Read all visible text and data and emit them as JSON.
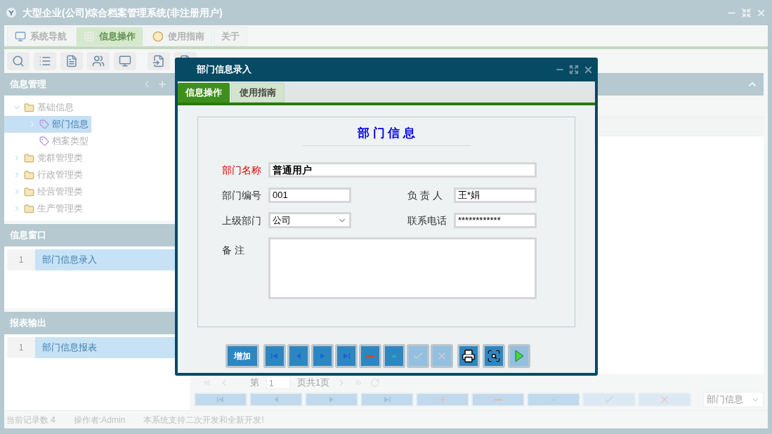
{
  "app": {
    "title": "大型企业(公司)综合档案管理系统(非注册用户)"
  },
  "main_tabs": [
    {
      "label": "系统导航",
      "selected": false,
      "kind": "monitor"
    },
    {
      "label": "信息操作",
      "selected": true,
      "kind": "grid"
    },
    {
      "label": "使用指南",
      "selected": false,
      "kind": "clock"
    },
    {
      "label": "关于",
      "selected": false,
      "kind": "none"
    }
  ],
  "toolbar": [
    {
      "kind": "search"
    },
    {
      "kind": "list"
    },
    {
      "kind": "document"
    },
    {
      "kind": "users"
    },
    {
      "kind": "monitor"
    },
    {
      "kind": "import"
    },
    {
      "kind": "document"
    }
  ],
  "sidebar": {
    "title": "信息管理",
    "tree": [
      {
        "label": "基础信息",
        "kind": "folder",
        "expanded": true,
        "selected": false,
        "children": [
          {
            "label": "部门信息",
            "kind": "leaf",
            "expanded": false,
            "selected": true
          },
          {
            "label": "档案类型",
            "kind": "leaf",
            "selected": false
          }
        ]
      },
      {
        "label": "党群管理类",
        "kind": "folder",
        "expanded": false,
        "selected": false
      },
      {
        "label": "行政管理类",
        "kind": "folder",
        "expanded": false,
        "selected": false
      },
      {
        "label": "经营管理类",
        "kind": "folder",
        "expanded": false,
        "selected": false
      },
      {
        "label": "生产管理类",
        "kind": "folder",
        "expanded": false,
        "selected": false
      }
    ]
  },
  "windows": {
    "title": "信息窗口",
    "items": [
      {
        "index": "1",
        "label": "部门信息录入"
      }
    ]
  },
  "reports": {
    "title": "报表输出",
    "items": [
      {
        "index": "1",
        "label": "部门信息报表"
      }
    ]
  },
  "pager": {
    "prefix": "第",
    "page": "1",
    "suffix": "页共1页"
  },
  "grid_buttons": [
    {
      "kind": "first",
      "disabled": false
    },
    {
      "kind": "prev",
      "disabled": false
    },
    {
      "kind": "next",
      "disabled": false
    },
    {
      "kind": "last",
      "disabled": false
    },
    {
      "kind": "plus",
      "disabled": false
    },
    {
      "kind": "minus",
      "disabled": false
    },
    {
      "kind": "up",
      "disabled": false
    },
    {
      "kind": "check",
      "disabled": true
    },
    {
      "kind": "x",
      "disabled": true
    }
  ],
  "filter_select": {
    "value": "部门信息"
  },
  "status_bar": [
    "当前记录数 4",
    "操作者:Admin",
    "本系统支持二次开发和全新开发!"
  ],
  "dialog": {
    "title": "部门信息录入",
    "tabs": [
      {
        "label": "信息操作",
        "selected": true
      },
      {
        "label": "使用指南",
        "selected": false
      }
    ],
    "form": {
      "heading": "部 门 信 息",
      "rows": [
        [
          {
            "label": "部门名称",
            "value": "普通用户",
            "required": true,
            "bold": true,
            "kind": "text"
          }
        ],
        [
          {
            "label": "部门编号",
            "value": "001",
            "required": false,
            "bold": false,
            "kind": "text"
          },
          {
            "label": "负 责 人",
            "value": "王*娟",
            "required": false,
            "bold": false,
            "kind": "text"
          }
        ],
        [
          {
            "label": "上级部门",
            "value": "公司",
            "required": false,
            "bold": false,
            "kind": "select"
          },
          {
            "label": "联系电话",
            "value": "************",
            "required": false,
            "bold": false,
            "kind": "text"
          }
        ],
        [
          {
            "label": "备 注",
            "required": false,
            "kind": "textarea"
          }
        ]
      ]
    },
    "buttons": [
      {
        "kind": "text",
        "label": "增加",
        "disabled": false
      },
      {
        "kind": "first",
        "disabled": false
      },
      {
        "kind": "prev",
        "disabled": false
      },
      {
        "kind": "next",
        "disabled": false
      },
      {
        "kind": "last",
        "disabled": false
      },
      {
        "kind": "minus",
        "disabled": false
      },
      {
        "kind": "up",
        "disabled": false
      },
      {
        "kind": "check",
        "disabled": true
      },
      {
        "kind": "x",
        "disabled": true
      },
      {
        "kind": "print",
        "disabled": false
      },
      {
        "kind": "preview",
        "disabled": false
      },
      {
        "kind": "play",
        "disabled": true
      }
    ]
  }
}
